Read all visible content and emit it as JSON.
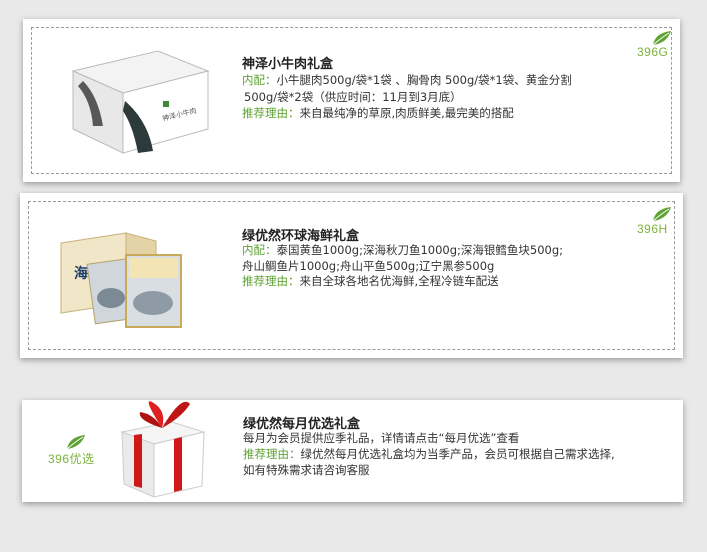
{
  "cards": [
    {
      "code": "396G",
      "title": "神泽小牛肉礼盒",
      "contents_label": "内配：",
      "contents_line1": "小牛腿肉500g/袋*1袋 、胸骨肉 500g/袋*1袋、黄金分割",
      "contents_line2": "500g/袋*2袋（供应时间：11月到3月底）",
      "reason_label": "推荐理由：",
      "reason": "来自最纯净的草原,肉质鲜美,最完美的搭配",
      "box_label": "神泽小牛肉"
    },
    {
      "code": "396H",
      "title": "绿优然环球海鲜礼盒",
      "contents_label": "内配：",
      "contents_line1": "泰国黄鱼1000g;深海秋刀鱼1000g;深海银鳕鱼块500g;",
      "contents_line2": "舟山鲷鱼片1000g;舟山平鱼500g;辽宁黑参500g",
      "reason_label": "推荐理由：",
      "reason": "来自全球各地名优海鲜,全程冷链车配送",
      "box_label": "海之味"
    },
    {
      "code": "396优选",
      "title": "绿优然每月优选礼盒",
      "desc": "每月为会员提供应季礼品，详情请点击“每月优选”查看",
      "reason_label": "推荐理由：",
      "reason_line1": "绿优然每月优选礼盒均为当季产品，会员可根据自己需求选择,",
      "reason_line2": "如有特殊需求请咨询客服"
    }
  ],
  "colors": {
    "accent": "#5ea232",
    "code": "#7bb33b",
    "ribbon": "#d01818"
  },
  "icons": {
    "leaf": "leaf-icon",
    "gift": "gift-box-icon"
  }
}
